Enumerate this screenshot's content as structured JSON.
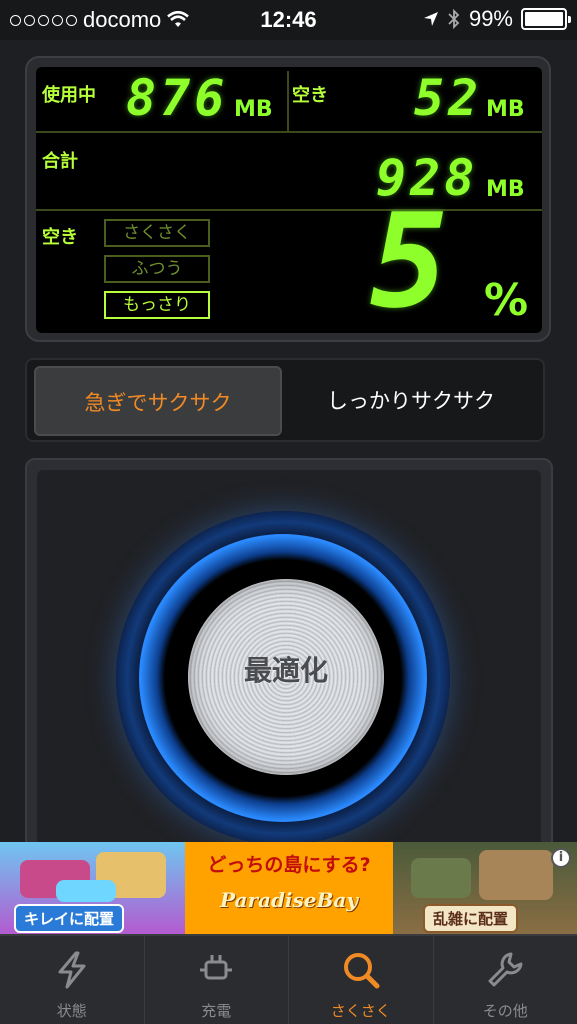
{
  "status_bar": {
    "carrier": "docomo",
    "time": "12:46",
    "battery": "99%",
    "icons": [
      "signal-dots-icon",
      "wifi-icon",
      "location-arrow-icon",
      "bluetooth-icon",
      "battery-icon"
    ]
  },
  "memory": {
    "used_label": "使用中",
    "used_value": "876",
    "used_unit": "MB",
    "free_label": "空き",
    "free_value": "52",
    "free_unit": "MB",
    "total_label": "合計",
    "total_value": "928",
    "total_unit": "MB",
    "free_pct_label": "空き",
    "free_pct_value": "5",
    "free_pct_unit": "%",
    "levels": [
      {
        "label": "さくさく",
        "active": false
      },
      {
        "label": "ふつう",
        "active": false
      },
      {
        "label": "もっさり",
        "active": true
      }
    ]
  },
  "mode_selector": {
    "options": [
      "急ぎでサクサク",
      "しっかりサクサク"
    ],
    "selected": "急ぎでサクサク"
  },
  "optimize_button": {
    "label": "最適化"
  },
  "ad_banner": {
    "headline": "どっちの島にする?",
    "logo_text": "ParadiseBay",
    "left_caption": "キレイに配置",
    "right_caption": "乱雑に配置",
    "info_symbol": "i"
  },
  "tab_bar": {
    "items": [
      {
        "label": "状態",
        "icon": "lightning-icon"
      },
      {
        "label": "充電",
        "icon": "plug-icon"
      },
      {
        "label": "さくさく",
        "icon": "magnifier-icon"
      },
      {
        "label": "その他",
        "icon": "wrench-icon"
      }
    ],
    "selected": "さくさく"
  },
  "colors": {
    "lcd_green": "#8eff2a",
    "accent_orange": "#f08a24",
    "ring_blue": "#2b8bff"
  }
}
